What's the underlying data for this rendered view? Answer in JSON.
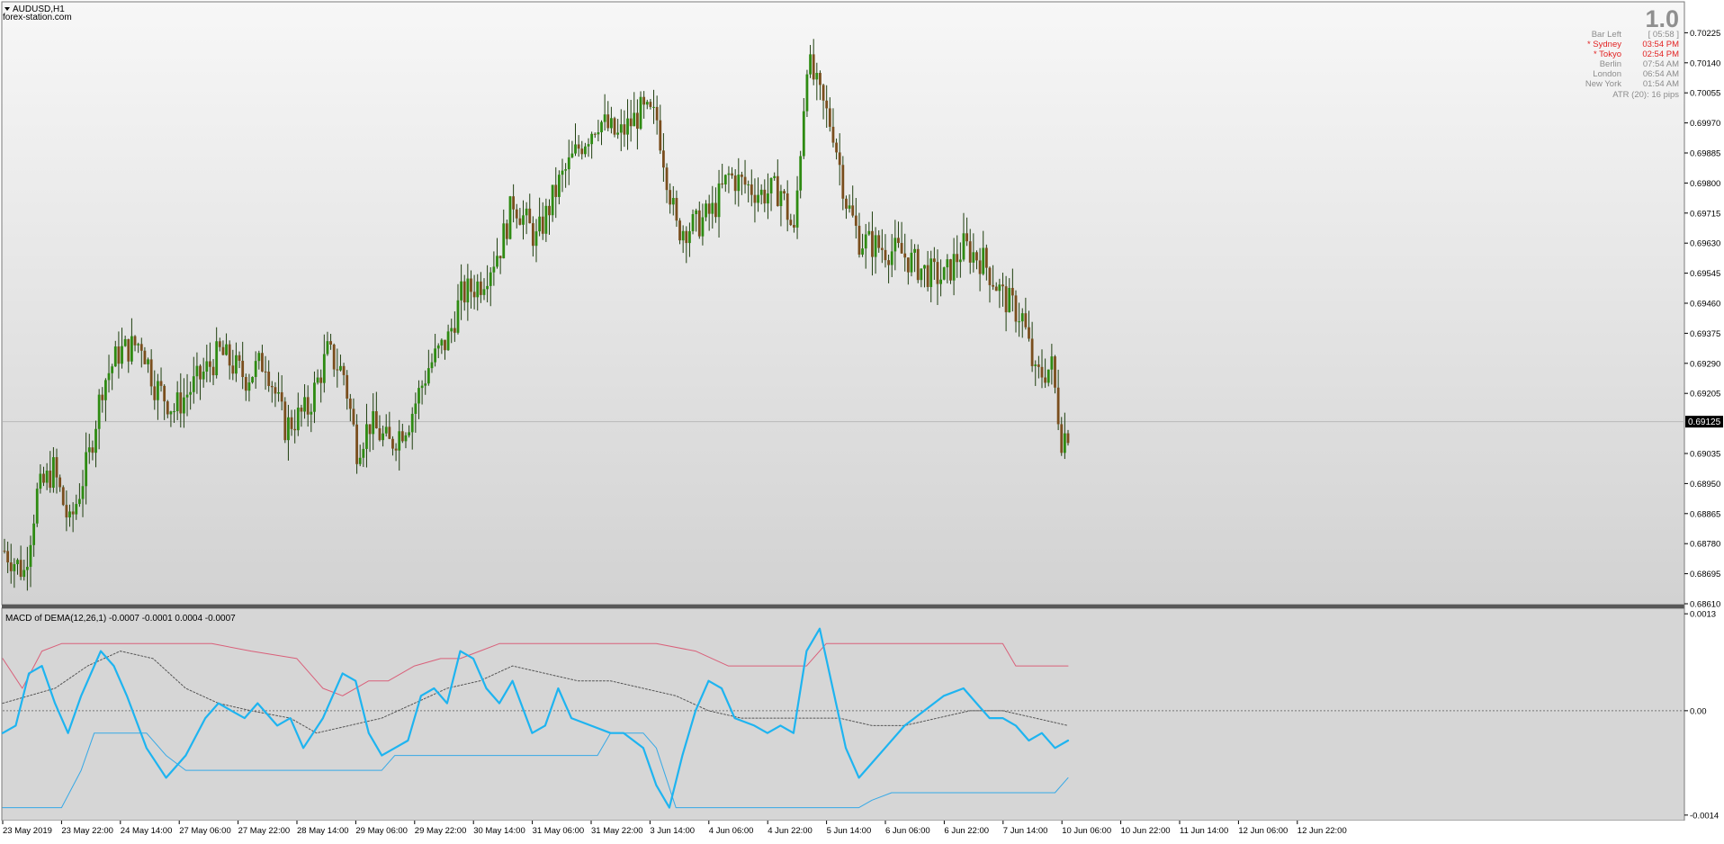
{
  "colors": {
    "chart_bg_top": "#f7f7f7",
    "chart_bg_bottom": "#d2d2d2",
    "bull_candle": "#2e8b12",
    "bear_candle": "#7a4e1d",
    "wick": "#1f3f0f",
    "macd_line": "#1eb4f0",
    "upper_band": "#d9607a",
    "lower_band": "#36a9e6",
    "signal_dotted": "#555555",
    "price_line": "#b9b9b9",
    "price_tag_bg": "#000000",
    "price_tag_text": "#ffffff",
    "red_session": "#e22222",
    "gray_session": "#8c8c8c",
    "bar_count_color": "#8f8f8f",
    "separator": "#585858"
  },
  "header": {
    "symbol": "AUDUSD,H1",
    "watermark": "forex-station.com",
    "menu_icon": "triangle-down-icon"
  },
  "info_panel": {
    "bar_count": "1.0",
    "rows": [
      {
        "label": "Bar Left",
        "value": "[ 05:58 ]",
        "highlight": false
      },
      {
        "label": "* Sydney",
        "value": "03:54 PM",
        "highlight": true
      },
      {
        "label": "* Tokyo",
        "value": "02:54 PM",
        "highlight": true
      },
      {
        "label": "Berlin",
        "value": "07:54 AM",
        "highlight": false
      },
      {
        "label": "London",
        "value": "06:54 AM",
        "highlight": false
      },
      {
        "label": "New York",
        "value": "01:54 AM",
        "highlight": false
      }
    ],
    "atr": "ATR (20): 16 pips"
  },
  "indicator": {
    "title": "MACD of DEMA(12,26,1) -0.0007 -0.0001 0.0004 -0.0007"
  },
  "chart_data": [
    {
      "type": "candlestick",
      "title": "AUDUSD,H1",
      "price_axis_ticks": [
        "0.70225",
        "0.70140",
        "0.70055",
        "0.69970",
        "0.69885",
        "0.69800",
        "0.69715",
        "0.69630",
        "0.69545",
        "0.69460",
        "0.69375",
        "0.69290",
        "0.69205",
        "0.69035",
        "0.68950",
        "0.68865",
        "0.68780",
        "0.68695",
        "0.68610"
      ],
      "ylim": [
        0.6861,
        0.7031
      ],
      "current_price": "0.69125",
      "grid": false,
      "x_tick_labels": [
        "23 May 2019",
        "23 May 22:00",
        "24 May 14:00",
        "27 May 06:00",
        "27 May 22:00",
        "28 May 14:00",
        "29 May 06:00",
        "29 May 22:00",
        "30 May 14:00",
        "31 May 06:00",
        "31 May 22:00",
        "3 Jun 14:00",
        "4 Jun 06:00",
        "4 Jun 22:00",
        "5 Jun 14:00",
        "6 Jun 06:00",
        "6 Jun 22:00",
        "7 Jun 14:00",
        "10 Jun 06:00",
        "10 Jun 22:00",
        "11 Jun 14:00",
        "12 Jun 06:00",
        "12 Jun 22:00"
      ],
      "price_path_keypoints": [
        [
          0,
          0.6876
        ],
        [
          6,
          0.687
        ],
        [
          10,
          0.6892
        ],
        [
          15,
          0.6899
        ],
        [
          20,
          0.6883
        ],
        [
          26,
          0.6903
        ],
        [
          30,
          0.6923
        ],
        [
          35,
          0.6932
        ],
        [
          42,
          0.6935
        ],
        [
          46,
          0.6923
        ],
        [
          52,
          0.6916
        ],
        [
          60,
          0.6925
        ],
        [
          66,
          0.6932
        ],
        [
          74,
          0.6925
        ],
        [
          80,
          0.693
        ],
        [
          86,
          0.6911
        ],
        [
          93,
          0.6916
        ],
        [
          99,
          0.6932
        ],
        [
          104,
          0.6926
        ],
        [
          108,
          0.6905
        ],
        [
          112,
          0.6912
        ],
        [
          118,
          0.6906
        ],
        [
          124,
          0.6913
        ],
        [
          130,
          0.6928
        ],
        [
          136,
          0.6936
        ],
        [
          140,
          0.6948
        ],
        [
          146,
          0.6952
        ],
        [
          152,
          0.6962
        ],
        [
          156,
          0.6975
        ],
        [
          163,
          0.6964
        ],
        [
          170,
          0.698
        ],
        [
          176,
          0.699
        ],
        [
          182,
          0.6998
        ],
        [
          188,
          0.6993
        ],
        [
          195,
          0.7
        ],
        [
          200,
          0.6998
        ],
        [
          206,
          0.6967
        ],
        [
          212,
          0.6968
        ],
        [
          217,
          0.6972
        ],
        [
          222,
          0.6982
        ],
        [
          226,
          0.698
        ],
        [
          232,
          0.6977
        ],
        [
          238,
          0.6978
        ],
        [
          242,
          0.6965
        ],
        [
          246,
          0.7015
        ],
        [
          250,
          0.7004
        ],
        [
          254,
          0.6995
        ],
        [
          258,
          0.6975
        ],
        [
          262,
          0.6964
        ],
        [
          268,
          0.6962
        ],
        [
          275,
          0.696
        ],
        [
          282,
          0.6955
        ],
        [
          288,
          0.6953
        ],
        [
          294,
          0.6962
        ],
        [
          300,
          0.6958
        ],
        [
          306,
          0.6948
        ],
        [
          312,
          0.6942
        ],
        [
          316,
          0.6925
        ],
        [
          321,
          0.6928
        ],
        [
          324,
          0.6908
        ],
        [
          326,
          0.691
        ]
      ]
    },
    {
      "type": "line",
      "title": "MACD of DEMA(12,26,1)",
      "values_shown": [
        "-0.0007",
        "-0.0001",
        "0.0004",
        "-0.0007"
      ],
      "axis_ticks": [
        "0.0013",
        "0.00",
        "-0.0014"
      ],
      "ylim": [
        -0.00145,
        0.00135
      ],
      "grid": false,
      "series": [
        {
          "style": "solid-thick",
          "color": "#1eb4f0",
          "points": [
            [
              0,
              -0.0003
            ],
            [
              4,
              -0.0002
            ],
            [
              8,
              0.0005
            ],
            [
              12,
              0.0006
            ],
            [
              16,
              0.0001
            ],
            [
              20,
              -0.0003
            ],
            [
              24,
              0.0002
            ],
            [
              30,
              0.0008
            ],
            [
              34,
              0.0006
            ],
            [
              38,
              0.0002
            ],
            [
              44,
              -0.0005
            ],
            [
              50,
              -0.0009
            ],
            [
              56,
              -0.0006
            ],
            [
              62,
              -0.0001
            ],
            [
              66,
              0.0001
            ],
            [
              70,
              0.0
            ],
            [
              74,
              -0.0001
            ],
            [
              78,
              0.0001
            ],
            [
              84,
              -0.0002
            ],
            [
              88,
              -0.0001
            ],
            [
              92,
              -0.0005
            ],
            [
              98,
              -0.0001
            ],
            [
              104,
              0.0005
            ],
            [
              108,
              0.0004
            ],
            [
              112,
              -0.0003
            ],
            [
              116,
              -0.0006
            ],
            [
              120,
              -0.0005
            ],
            [
              124,
              -0.0004
            ],
            [
              128,
              0.0002
            ],
            [
              132,
              0.0003
            ],
            [
              136,
              0.0001
            ],
            [
              140,
              0.0008
            ],
            [
              144,
              0.0007
            ],
            [
              148,
              0.0003
            ],
            [
              152,
              0.0001
            ],
            [
              156,
              0.0004
            ],
            [
              162,
              -0.0003
            ],
            [
              166,
              -0.0002
            ],
            [
              170,
              0.0003
            ],
            [
              174,
              -0.0001
            ],
            [
              180,
              -0.0002
            ],
            [
              186,
              -0.0003
            ],
            [
              190,
              -0.0003
            ],
            [
              196,
              -0.0005
            ],
            [
              200,
              -0.001
            ],
            [
              204,
              -0.0013
            ],
            [
              208,
              -0.0006
            ],
            [
              212,
              0.0
            ],
            [
              216,
              0.0004
            ],
            [
              220,
              0.0003
            ],
            [
              224,
              -0.0001
            ],
            [
              230,
              -0.0002
            ],
            [
              234,
              -0.0003
            ],
            [
              238,
              -0.0002
            ],
            [
              242,
              -0.0003
            ],
            [
              246,
              0.0008
            ],
            [
              250,
              0.0011
            ],
            [
              254,
              0.0003
            ],
            [
              258,
              -0.0005
            ],
            [
              262,
              -0.0009
            ],
            [
              266,
              -0.0007
            ],
            [
              270,
              -0.0005
            ],
            [
              276,
              -0.0002
            ],
            [
              282,
              0.0
            ],
            [
              288,
              0.0002
            ],
            [
              294,
              0.0003
            ],
            [
              298,
              0.0001
            ],
            [
              302,
              -0.0001
            ],
            [
              306,
              -0.0001
            ],
            [
              310,
              -0.0002
            ],
            [
              314,
              -0.0004
            ],
            [
              318,
              -0.0003
            ],
            [
              322,
              -0.0005
            ],
            [
              326,
              -0.0004
            ]
          ]
        },
        {
          "style": "upper-band",
          "color": "#d9607a",
          "points": [
            [
              0,
              0.0007
            ],
            [
              6,
              0.0003
            ],
            [
              12,
              0.0008
            ],
            [
              18,
              0.0009
            ],
            [
              30,
              0.0009
            ],
            [
              40,
              0.0009
            ],
            [
              52,
              0.0009
            ],
            [
              64,
              0.0009
            ],
            [
              76,
              0.0008
            ],
            [
              90,
              0.0007
            ],
            [
              98,
              0.0003
            ],
            [
              104,
              0.0002
            ],
            [
              112,
              0.0004
            ],
            [
              118,
              0.0004
            ],
            [
              126,
              0.0006
            ],
            [
              134,
              0.0007
            ],
            [
              140,
              0.0007
            ],
            [
              146,
              0.0008
            ],
            [
              152,
              0.0009
            ],
            [
              160,
              0.0009
            ],
            [
              180,
              0.0009
            ],
            [
              200,
              0.0009
            ],
            [
              212,
              0.0008
            ],
            [
              222,
              0.0006
            ],
            [
              232,
              0.0006
            ],
            [
              240,
              0.0006
            ],
            [
              246,
              0.0006
            ],
            [
              252,
              0.0009
            ],
            [
              270,
              0.0009
            ],
            [
              290,
              0.0009
            ],
            [
              306,
              0.0009
            ],
            [
              310,
              0.0006
            ],
            [
              320,
              0.0006
            ],
            [
              326,
              0.0006
            ]
          ]
        },
        {
          "style": "lower-band",
          "color": "#36a9e6",
          "points": [
            [
              0,
              -0.0013
            ],
            [
              10,
              -0.0013
            ],
            [
              18,
              -0.0013
            ],
            [
              24,
              -0.0008
            ],
            [
              28,
              -0.0003
            ],
            [
              34,
              -0.0003
            ],
            [
              44,
              -0.0003
            ],
            [
              50,
              -0.0006
            ],
            [
              56,
              -0.0008
            ],
            [
              80,
              -0.0008
            ],
            [
              100,
              -0.0008
            ],
            [
              116,
              -0.0008
            ],
            [
              120,
              -0.0006
            ],
            [
              140,
              -0.0006
            ],
            [
              160,
              -0.0006
            ],
            [
              182,
              -0.0006
            ],
            [
              186,
              -0.0003
            ],
            [
              196,
              -0.0003
            ],
            [
              200,
              -0.0005
            ],
            [
              206,
              -0.0013
            ],
            [
              220,
              -0.0013
            ],
            [
              240,
              -0.0013
            ],
            [
              256,
              -0.0013
            ],
            [
              262,
              -0.0013
            ],
            [
              266,
              -0.0012
            ],
            [
              272,
              -0.0011
            ],
            [
              280,
              -0.0011
            ],
            [
              300,
              -0.0011
            ],
            [
              322,
              -0.0011
            ],
            [
              326,
              -0.0009
            ]
          ]
        },
        {
          "style": "dotted-signal",
          "color": "#555555",
          "points": [
            [
              0,
              0.0001
            ],
            [
              8,
              0.0002
            ],
            [
              16,
              0.0003
            ],
            [
              26,
              0.0006
            ],
            [
              36,
              0.0008
            ],
            [
              46,
              0.0007
            ],
            [
              56,
              0.0003
            ],
            [
              66,
              0.0001
            ],
            [
              76,
              0.0
            ],
            [
              88,
              -0.0001
            ],
            [
              96,
              -0.0003
            ],
            [
              106,
              -0.0002
            ],
            [
              116,
              -0.0001
            ],
            [
              126,
              0.0001
            ],
            [
              136,
              0.0003
            ],
            [
              146,
              0.0004
            ],
            [
              156,
              0.0006
            ],
            [
              166,
              0.0005
            ],
            [
              176,
              0.0004
            ],
            [
              186,
              0.0004
            ],
            [
              196,
              0.0003
            ],
            [
              206,
              0.0002
            ],
            [
              216,
              0.0
            ],
            [
              226,
              -0.0001
            ],
            [
              236,
              -0.0001
            ],
            [
              246,
              -0.0001
            ],
            [
              256,
              -0.0001
            ],
            [
              266,
              -0.0002
            ],
            [
              276,
              -0.0002
            ],
            [
              286,
              -0.0001
            ],
            [
              296,
              0.0
            ],
            [
              306,
              0.0
            ],
            [
              316,
              -0.0001
            ],
            [
              326,
              -0.0002
            ]
          ]
        }
      ]
    }
  ]
}
